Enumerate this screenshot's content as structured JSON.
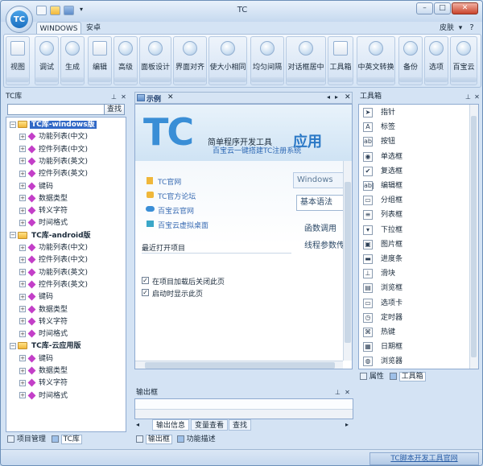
{
  "window": {
    "title": "TC",
    "logo_text": "TC",
    "minimize": "–",
    "maximize": "□",
    "close": "✕"
  },
  "ribbon_tabs": {
    "windows": "WINDOWS",
    "android": "安卓",
    "skin": "皮肤"
  },
  "ribbon_buttons": [
    "视图",
    "调试",
    "生成",
    "编辑",
    "高级",
    "面板设计",
    "界面对齐",
    "使大小相同",
    "均匀间隔",
    "对话框居中",
    "工具箱",
    "中英文转换",
    "备份",
    "选项",
    "百宝云"
  ],
  "left_panel": {
    "title": "TC库",
    "search_value": "",
    "search_button": "查找",
    "tree": [
      {
        "label": "TC库-windows版",
        "level": 0,
        "folder": true,
        "selected": true
      },
      {
        "label": "功能列表(中文)",
        "level": 1
      },
      {
        "label": "控件列表(中文)",
        "level": 1
      },
      {
        "label": "功能列表(英文)",
        "level": 1
      },
      {
        "label": "控件列表(英文)",
        "level": 1
      },
      {
        "label": "键码",
        "level": 1
      },
      {
        "label": "数据类型",
        "level": 1
      },
      {
        "label": "转义字符",
        "level": 1
      },
      {
        "label": "时间格式",
        "level": 1
      },
      {
        "label": "TC库-android版",
        "level": 0,
        "folder": true
      },
      {
        "label": "功能列表(中文)",
        "level": 1
      },
      {
        "label": "控件列表(中文)",
        "level": 1
      },
      {
        "label": "功能列表(英文)",
        "level": 1
      },
      {
        "label": "控件列表(英文)",
        "level": 1
      },
      {
        "label": "键码",
        "level": 1
      },
      {
        "label": "数据类型",
        "level": 1
      },
      {
        "label": "转义字符",
        "level": 1
      },
      {
        "label": "时间格式",
        "level": 1
      },
      {
        "label": "TC库-云应用版",
        "level": 0,
        "folder": true
      },
      {
        "label": "键码",
        "level": 1
      },
      {
        "label": "数据类型",
        "level": 1
      },
      {
        "label": "转义字符",
        "level": 1
      },
      {
        "label": "时间格式",
        "level": 1
      }
    ],
    "bottom_tabs": [
      "项目管理",
      "TC库"
    ]
  },
  "center": {
    "doc_tab": "示例",
    "banner_logo": "TC",
    "banner_title": "简单程序开发工具",
    "banner_subtitle": "百宝云一键搭建TC注册系统",
    "banner_side": "应用",
    "links": [
      "TC官网",
      "TC官方论坛",
      "百宝云官网",
      "百宝云虚拟桌面"
    ],
    "recent_title": "最近打开项目",
    "side_tabs": [
      "Windows",
      "基本语法"
    ],
    "side_items": [
      "函数调用",
      "线程参数传"
    ],
    "options": [
      {
        "label": "在项目加载后关闭此页",
        "checked": true
      },
      {
        "label": "启动时显示此页",
        "checked": true
      }
    ]
  },
  "output": {
    "title": "输出框",
    "tabs": [
      "输出信息",
      "变量查看",
      "查找"
    ],
    "bottom_tabs": [
      "输出框",
      "功能描述"
    ]
  },
  "toolbox": {
    "title": "工具箱",
    "items": [
      {
        "label": "指针",
        "icon": "pointer-icon",
        "glyph": "➤"
      },
      {
        "label": "标签",
        "icon": "label-icon",
        "glyph": "A"
      },
      {
        "label": "按钮",
        "icon": "button-icon",
        "glyph": "ab"
      },
      {
        "label": "单选框",
        "icon": "radio-icon",
        "glyph": "◉"
      },
      {
        "label": "复选框",
        "icon": "checkbox-icon",
        "glyph": "✔"
      },
      {
        "label": "编辑框",
        "icon": "editbox-icon",
        "glyph": "ab|"
      },
      {
        "label": "分组框",
        "icon": "groupbox-icon",
        "glyph": "▭"
      },
      {
        "label": "列表框",
        "icon": "listbox-icon",
        "glyph": "≡"
      },
      {
        "label": "下拉框",
        "icon": "combobox-icon",
        "glyph": "▾"
      },
      {
        "label": "图片框",
        "icon": "picture-icon",
        "glyph": "▣"
      },
      {
        "label": "进度条",
        "icon": "progressbar-icon",
        "glyph": "▬"
      },
      {
        "label": "滑块",
        "icon": "slider-icon",
        "glyph": "⊥"
      },
      {
        "label": "浏览框",
        "icon": "browse-icon",
        "glyph": "▤"
      },
      {
        "label": "选项卡",
        "icon": "tabs-icon",
        "glyph": "▭"
      },
      {
        "label": "定时器",
        "icon": "timer-icon",
        "glyph": "◷"
      },
      {
        "label": "热键",
        "icon": "hotkey-icon",
        "glyph": "⌘"
      },
      {
        "label": "日期框",
        "icon": "date-icon",
        "glyph": "▦"
      },
      {
        "label": "浏览器",
        "icon": "browser-icon",
        "glyph": "◍"
      }
    ],
    "bottom_tabs": [
      "属性",
      "工具箱"
    ]
  },
  "statusbar": {
    "link": "TC脚本开发工具官网"
  }
}
